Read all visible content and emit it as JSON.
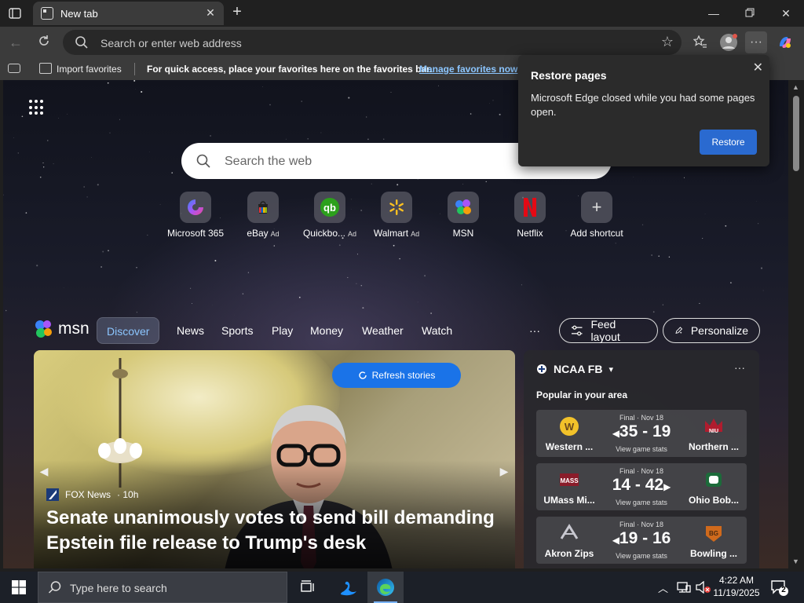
{
  "browser": {
    "tab_title": "New tab",
    "address_placeholder": "Search or enter web address"
  },
  "favorites_bar": {
    "import_label": "Import favorites",
    "message": "For quick access, place your favorites here on the favorites bar.",
    "manage_link": "Manage favorites now"
  },
  "restore_popup": {
    "title": "Restore pages",
    "message": "Microsoft Edge closed while you had some pages open.",
    "button": "Restore"
  },
  "search": {
    "placeholder": "Search the web"
  },
  "shortcuts": [
    {
      "label": "Microsoft 365",
      "ad": "",
      "icon": "microsoft-365-icon"
    },
    {
      "label": "eBay",
      "ad": "Ad",
      "icon": "ebay-icon"
    },
    {
      "label": "Quickbo...",
      "ad": "Ad",
      "icon": "quickbooks-icon"
    },
    {
      "label": "Walmart",
      "ad": "Ad",
      "icon": "walmart-icon"
    },
    {
      "label": "MSN",
      "ad": "",
      "icon": "msn-icon"
    },
    {
      "label": "Netflix",
      "ad": "",
      "icon": "netflix-icon"
    },
    {
      "label": "Add shortcut",
      "ad": "",
      "icon": "plus-icon"
    }
  ],
  "msn": {
    "logo": "msn",
    "nav": [
      "Discover",
      "News",
      "Sports",
      "Play",
      "Money",
      "Weather",
      "Watch"
    ],
    "more": "···",
    "feed_layout": "Feed layout",
    "personalize": "Personalize"
  },
  "hero": {
    "refresh": "Refresh stories",
    "source": "FOX News",
    "age": "· 10h",
    "headline": "Senate unanimously votes to send bill demanding Epstein file release to Trump's desk"
  },
  "sports": {
    "league": "NCAA FB",
    "subtitle": "Popular in your area",
    "games": [
      {
        "status": "Final · Nov 18",
        "score": "35 - 19",
        "winner_arrow": "left",
        "left_team": "Western ...",
        "right_team": "Northern ...",
        "stats": "View game stats",
        "left_color": "#6b4a1c",
        "right_color": "#b01c2e"
      },
      {
        "status": "Final · Nov 18",
        "score": "14 - 42",
        "winner_arrow": "right",
        "left_team": "UMass Mi...",
        "right_team": "Ohio Bob...",
        "stats": "View game stats",
        "left_color": "#8a1c2a",
        "right_color": "#1c6b3a"
      },
      {
        "status": "Final · Nov 18",
        "score": "19 - 16",
        "winner_arrow": "left",
        "left_team": "Akron Zips",
        "right_team": "Bowling ...",
        "stats": "View game stats",
        "left_color": "#1c2a5a",
        "right_color": "#d06a1c"
      }
    ]
  },
  "taskbar": {
    "search_placeholder": "Type here to search",
    "time": "4:22 AM",
    "date": "11/19/2025",
    "notifications": "2"
  },
  "colors": {
    "accent_blue": "#1a73e8",
    "link_blue": "#8cc6ff",
    "restore_button": "#2a6ad0"
  }
}
